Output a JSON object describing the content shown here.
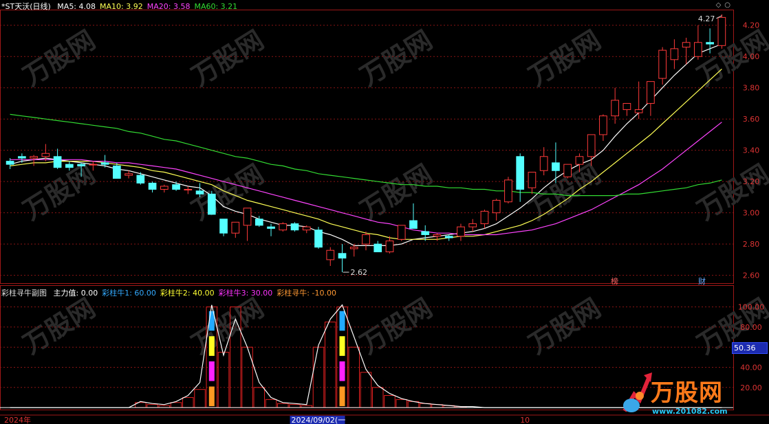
{
  "main_header": {
    "stock": "*ST天沃(日线)",
    "indicators": [
      {
        "label": "MA5: 4.08",
        "color": "#ffffff"
      },
      {
        "label": "MA10: 3.92",
        "color": "#ffff55"
      },
      {
        "label": "MA20: 3.58",
        "color": "#ff44ff"
      },
      {
        "label": "MA60: 3.21",
        "color": "#33dd33"
      }
    ]
  },
  "corner_icons": [
    "diamond-icon",
    "circle-icon"
  ],
  "sub_header": {
    "title": "彩柱寻牛副图",
    "indicators": [
      {
        "label": "主力值: 0.00",
        "color": "#ffffff"
      },
      {
        "label": "彩柱牛1: 60.00",
        "color": "#33aaff"
      },
      {
        "label": "彩柱牛2: 40.00",
        "color": "#ffff33"
      },
      {
        "label": "彩柱牛3: 30.00",
        "color": "#ff33ff"
      },
      {
        "label": "彩柱寻牛: -10.00",
        "color": "#ff9933"
      }
    ]
  },
  "current_value_tag": "50.36",
  "brand": {
    "name": "万股网",
    "url": "www.201082.com",
    "watermark": "万股网",
    "watermark_url": "www.201082.com"
  },
  "flags": [
    {
      "text": "榜",
      "color": "#ff6666"
    },
    {
      "text": "财",
      "color": "#66aaff"
    }
  ],
  "chart_data": [
    {
      "type": "candlestick",
      "y_ticks": [
        "4.20",
        "4.00",
        "3.80",
        "3.60",
        "3.40",
        "3.20",
        "3.00",
        "2.80",
        "2.60"
      ],
      "ylim": [
        2.55,
        4.3
      ],
      "high_label": "4.27",
      "low_label": "2.62",
      "x_labels": [
        "2024年",
        "2024/09/02(一",
        "10"
      ],
      "candles": [
        [
          3.33,
          3.35,
          3.28,
          3.31
        ],
        [
          3.36,
          3.38,
          3.32,
          3.35
        ],
        [
          3.35,
          3.37,
          3.3,
          3.36
        ],
        [
          3.36,
          3.44,
          3.33,
          3.38
        ],
        [
          3.36,
          3.41,
          3.28,
          3.29
        ],
        [
          3.31,
          3.33,
          3.27,
          3.29
        ],
        [
          3.31,
          3.32,
          3.23,
          3.3
        ],
        [
          3.31,
          3.33,
          3.27,
          3.31
        ],
        [
          3.32,
          3.37,
          3.29,
          3.31
        ],
        [
          3.3,
          3.32,
          3.22,
          3.22
        ],
        [
          3.24,
          3.27,
          3.22,
          3.25
        ],
        [
          3.24,
          3.26,
          3.18,
          3.19
        ],
        [
          3.19,
          3.2,
          3.13,
          3.15
        ],
        [
          3.15,
          3.18,
          3.13,
          3.17
        ],
        [
          3.18,
          3.2,
          3.14,
          3.15
        ],
        [
          3.15,
          3.17,
          3.12,
          3.15
        ],
        [
          3.14,
          3.19,
          3.1,
          3.12
        ],
        [
          3.12,
          3.14,
          2.99,
          2.99
        ],
        [
          2.96,
          2.96,
          2.85,
          2.87
        ],
        [
          2.87,
          2.94,
          2.84,
          2.94
        ],
        [
          2.92,
          3.02,
          2.82,
          3.03
        ],
        [
          2.96,
          2.98,
          2.91,
          2.92
        ],
        [
          2.91,
          2.93,
          2.85,
          2.9
        ],
        [
          2.89,
          2.94,
          2.88,
          2.93
        ],
        [
          2.93,
          2.94,
          2.88,
          2.89
        ],
        [
          2.89,
          2.92,
          2.87,
          2.91
        ],
        [
          2.89,
          2.91,
          2.77,
          2.78
        ],
        [
          2.7,
          2.78,
          2.66,
          2.76
        ],
        [
          2.74,
          2.8,
          2.62,
          2.71
        ],
        [
          2.77,
          2.8,
          2.72,
          2.78
        ],
        [
          2.8,
          2.88,
          2.76,
          2.86
        ],
        [
          2.8,
          2.82,
          2.76,
          2.75
        ],
        [
          2.75,
          2.85,
          2.74,
          2.82
        ],
        [
          2.83,
          2.92,
          2.82,
          2.92
        ],
        [
          2.95,
          3.06,
          2.9,
          2.9
        ],
        [
          2.88,
          2.92,
          2.82,
          2.86
        ],
        [
          2.85,
          2.87,
          2.82,
          2.86
        ],
        [
          2.85,
          2.86,
          2.82,
          2.84
        ],
        [
          2.85,
          2.93,
          2.82,
          2.91
        ],
        [
          2.91,
          2.96,
          2.88,
          2.93
        ],
        [
          2.93,
          3.02,
          2.9,
          3.01
        ],
        [
          3.0,
          3.09,
          2.95,
          3.08
        ],
        [
          3.07,
          3.23,
          3.06,
          3.21
        ],
        [
          3.36,
          3.38,
          3.07,
          3.15
        ],
        [
          3.16,
          3.26,
          3.12,
          3.26
        ],
        [
          3.27,
          3.42,
          3.24,
          3.36
        ],
        [
          3.32,
          3.45,
          3.19,
          3.27
        ],
        [
          3.23,
          3.28,
          3.22,
          3.31
        ],
        [
          3.31,
          3.38,
          3.26,
          3.36
        ],
        [
          3.36,
          3.46,
          3.3,
          3.5
        ],
        [
          3.5,
          3.63,
          3.46,
          3.62
        ],
        [
          3.62,
          3.8,
          3.57,
          3.72
        ],
        [
          3.66,
          3.7,
          3.62,
          3.7
        ],
        [
          3.64,
          3.84,
          3.6,
          3.66
        ],
        [
          3.7,
          3.83,
          3.62,
          3.84
        ],
        [
          3.86,
          4.06,
          3.82,
          4.04
        ],
        [
          3.98,
          4.11,
          3.92,
          4.05
        ],
        [
          4.06,
          4.12,
          3.95,
          4.09
        ],
        [
          4.0,
          4.2,
          3.98,
          4.09
        ],
        [
          4.09,
          4.18,
          4.02,
          4.08
        ],
        [
          4.07,
          4.27,
          4.05,
          4.25
        ]
      ],
      "ma_series": [
        {
          "name": "MA5",
          "color": "#ffffff",
          "values": [
            3.31,
            3.33,
            3.34,
            3.35,
            3.34,
            3.33,
            3.32,
            3.31,
            3.3,
            3.28,
            3.27,
            3.25,
            3.23,
            3.21,
            3.19,
            3.17,
            3.16,
            3.11,
            3.04,
            3.01,
            2.99,
            2.96,
            2.94,
            2.92,
            2.92,
            2.91,
            2.88,
            2.86,
            2.83,
            2.79,
            2.79,
            2.79,
            2.79,
            2.8,
            2.83,
            2.84,
            2.85,
            2.86,
            2.87,
            2.88,
            2.9,
            2.93,
            2.98,
            3.03,
            3.09,
            3.16,
            3.22,
            3.27,
            3.31,
            3.34,
            3.4,
            3.49,
            3.57,
            3.64,
            3.72,
            3.8,
            3.88,
            3.95,
            4.02,
            4.05,
            4.08
          ]
        },
        {
          "name": "MA10",
          "color": "#ffff55",
          "values": [
            3.3,
            3.31,
            3.32,
            3.32,
            3.33,
            3.33,
            3.33,
            3.33,
            3.32,
            3.31,
            3.3,
            3.29,
            3.27,
            3.26,
            3.24,
            3.22,
            3.2,
            3.18,
            3.14,
            3.11,
            3.08,
            3.06,
            3.04,
            3.02,
            3.0,
            2.98,
            2.96,
            2.93,
            2.91,
            2.89,
            2.87,
            2.86,
            2.84,
            2.83,
            2.83,
            2.83,
            2.83,
            2.84,
            2.85,
            2.85,
            2.86,
            2.88,
            2.9,
            2.92,
            2.95,
            2.99,
            3.04,
            3.09,
            3.15,
            3.2,
            3.26,
            3.32,
            3.38,
            3.44,
            3.5,
            3.57,
            3.64,
            3.71,
            3.78,
            3.85,
            3.92
          ]
        },
        {
          "name": "MA20",
          "color": "#ff44ff",
          "values": [
            3.34,
            3.34,
            3.34,
            3.34,
            3.34,
            3.34,
            3.34,
            3.33,
            3.33,
            3.32,
            3.32,
            3.31,
            3.3,
            3.29,
            3.28,
            3.26,
            3.24,
            3.22,
            3.2,
            3.18,
            3.16,
            3.14,
            3.12,
            3.1,
            3.08,
            3.06,
            3.04,
            3.02,
            3.0,
            2.98,
            2.96,
            2.94,
            2.93,
            2.91,
            2.89,
            2.88,
            2.87,
            2.87,
            2.86,
            2.86,
            2.86,
            2.86,
            2.87,
            2.88,
            2.89,
            2.91,
            2.93,
            2.96,
            2.99,
            3.02,
            3.06,
            3.1,
            3.14,
            3.18,
            3.23,
            3.28,
            3.34,
            3.4,
            3.46,
            3.52,
            3.58
          ]
        },
        {
          "name": "MA60",
          "color": "#33dd33",
          "values": [
            3.63,
            3.62,
            3.61,
            3.6,
            3.59,
            3.58,
            3.57,
            3.56,
            3.55,
            3.54,
            3.52,
            3.51,
            3.49,
            3.47,
            3.46,
            3.44,
            3.42,
            3.4,
            3.38,
            3.36,
            3.35,
            3.33,
            3.31,
            3.3,
            3.28,
            3.27,
            3.25,
            3.24,
            3.23,
            3.22,
            3.21,
            3.2,
            3.19,
            3.18,
            3.18,
            3.17,
            3.17,
            3.16,
            3.16,
            3.15,
            3.15,
            3.14,
            3.14,
            3.13,
            3.13,
            3.12,
            3.12,
            3.11,
            3.11,
            3.11,
            3.11,
            3.11,
            3.12,
            3.12,
            3.13,
            3.14,
            3.15,
            3.16,
            3.18,
            3.19,
            3.21
          ]
        }
      ]
    },
    {
      "type": "bar",
      "y_ticks": [
        "100.00",
        "80.00",
        "60.00",
        "40.00",
        "20.00"
      ],
      "ylim": [
        -2,
        110
      ],
      "bars": [
        0,
        0,
        0,
        0,
        0,
        0,
        0,
        0,
        0,
        0,
        0,
        5,
        3,
        2,
        5,
        10,
        18,
        100,
        55,
        100,
        60,
        20,
        8,
        4,
        3,
        2,
        60,
        85,
        100,
        60,
        35,
        20,
        12,
        8,
        6,
        4,
        3,
        2,
        1,
        0,
        0,
        0,
        0,
        0,
        0,
        0,
        0,
        0,
        0,
        0,
        0,
        0,
        0,
        0,
        0,
        0,
        0,
        0,
        0,
        0,
        0
      ],
      "line": [
        0,
        0,
        0,
        0,
        0,
        0,
        0,
        0,
        0,
        0,
        0,
        6,
        4,
        3,
        6,
        12,
        25,
        102,
        52,
        88,
        60,
        25,
        10,
        5,
        4,
        3,
        62,
        88,
        102,
        70,
        38,
        22,
        14,
        9,
        6,
        4,
        3,
        2,
        1,
        1,
        0,
        0,
        0,
        0,
        0,
        0,
        0,
        0,
        0,
        0,
        0,
        0,
        0,
        0,
        0,
        0,
        0,
        0,
        0,
        0,
        0
      ],
      "baseline": 0,
      "color_columns": [
        {
          "index": 17,
          "segments": [
            "#22aaff",
            "#ffff22",
            "#ff22ff",
            "#ff9922"
          ]
        },
        {
          "index": 28,
          "segments": [
            "#22aaff",
            "#ffff22",
            "#ff22ff",
            "#ff9922"
          ]
        }
      ]
    }
  ]
}
